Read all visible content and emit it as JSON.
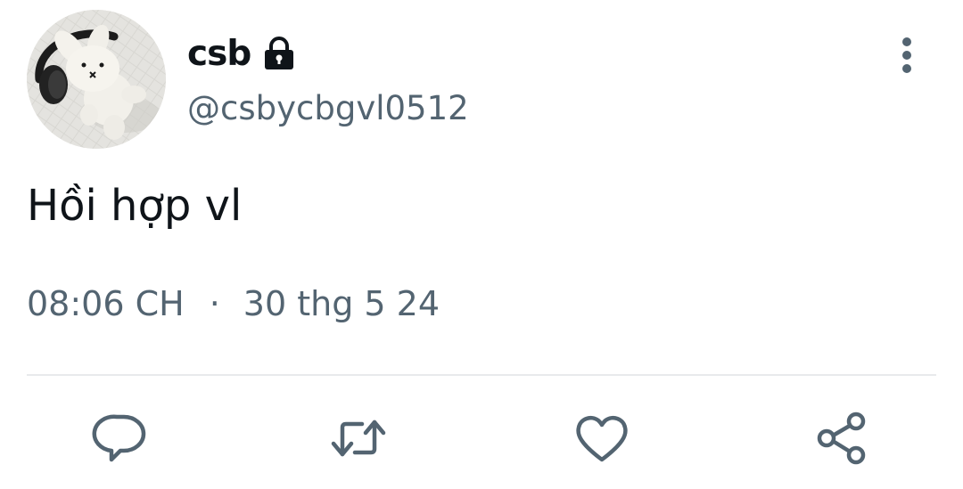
{
  "user": {
    "display_name": "csb",
    "handle": "@csbycbgvl0512",
    "protected_icon": "lock-icon",
    "avatar": "plush-bunny-with-headphones-photo"
  },
  "tweet": {
    "text": "Hồi hợp vl",
    "time": "08:06 CH",
    "separator": "·",
    "date": "30 thg 5 24"
  },
  "menu_icon": "more-vertical-icon",
  "actions": [
    {
      "icon": "reply-icon"
    },
    {
      "icon": "retweet-icon"
    },
    {
      "icon": "like-icon"
    },
    {
      "icon": "share-icon"
    }
  ],
  "colors": {
    "text_primary": "#0f1419",
    "text_secondary": "#536471",
    "icon": "#536471",
    "divider": "#e8eaec",
    "background": "#ffffff"
  }
}
